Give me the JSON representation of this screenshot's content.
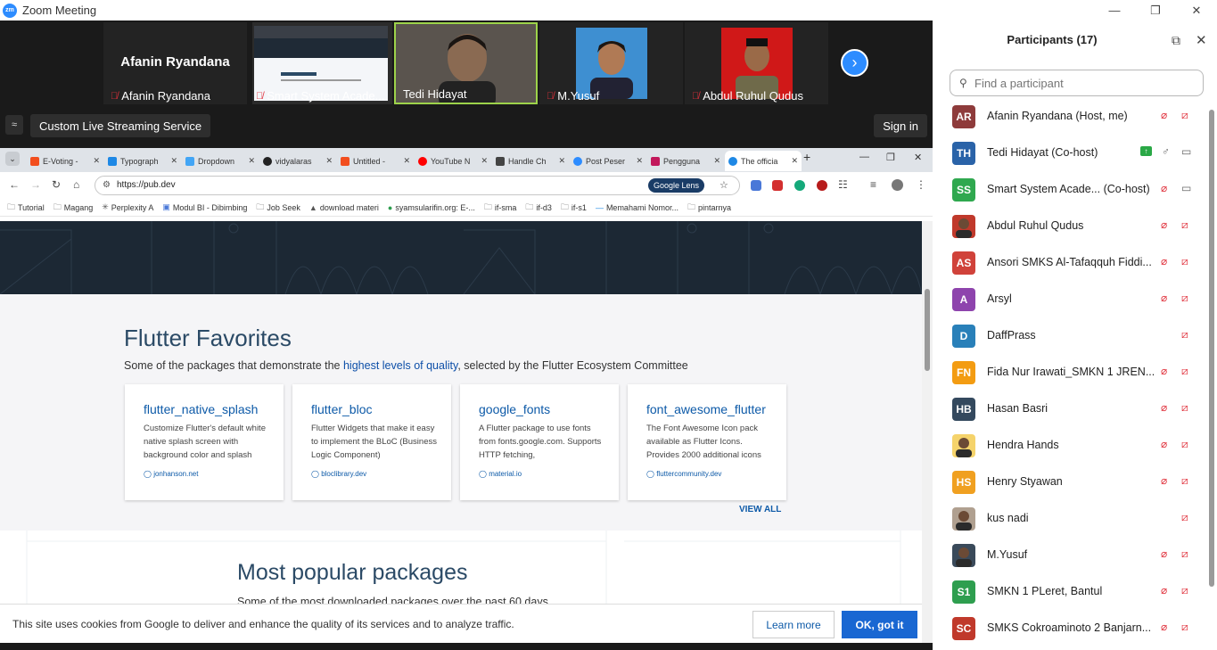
{
  "window": {
    "title": "Zoom Meeting"
  },
  "video_tiles": [
    {
      "name": "Afanin Ryandana",
      "big_name": "Afanin Ryandana",
      "muted": true,
      "bg": "#232323"
    },
    {
      "name": "Smart System Acade...",
      "muted": true,
      "bg": "#ffffff"
    },
    {
      "name": "Tedi Hidayat",
      "muted": false,
      "bg": "#4a4440"
    },
    {
      "name": "M.Yusuf",
      "muted": true,
      "bg": "#232323"
    },
    {
      "name": "Abdul Ruhul Qudus",
      "muted": true,
      "bg": "#232323"
    }
  ],
  "streaming": {
    "label": "Custom Live Streaming Service",
    "sign_in": "Sign in"
  },
  "browser": {
    "tabs": [
      {
        "label": "E-Voting - ",
        "color": "#f24e1e"
      },
      {
        "label": "Typograph",
        "color": "#1e88e5"
      },
      {
        "label": "Dropdown",
        "color": "#42a5f5"
      },
      {
        "label": "vidyalaras",
        "color": "#222222"
      },
      {
        "label": "Untitled - ",
        "color": "#f24e1e"
      },
      {
        "label": "YouTube N",
        "color": "#ff0000"
      },
      {
        "label": "Handle Ch",
        "color": "#444444"
      },
      {
        "label": "Post Peser",
        "color": "#2d8cff"
      },
      {
        "label": "Pengguna",
        "color": "#c2185b"
      },
      {
        "label": "The officia",
        "color": "#1e88e5"
      }
    ],
    "url": "https://pub.dev",
    "google_lens": "Google Lens",
    "bookmarks": [
      "Tutorial",
      "Magang",
      "Perplexity A",
      "Modul BI - Dibimbing",
      "Job Seek",
      "download materi",
      "syamsularifin.org: E-...",
      "if-sma",
      "if-d3",
      "if-s1",
      "Memahami Nomor...",
      "pintarnya"
    ]
  },
  "page": {
    "favorites_title": "Flutter Favorites",
    "favorites_sub_pre": "Some of the packages that demonstrate the ",
    "favorites_sub_link": "highest levels of quality",
    "favorites_sub_post": ", selected by the Flutter Ecosystem Committee",
    "cards": [
      {
        "name": "flutter_native_splash",
        "desc": "Customize Flutter's default white native splash screen with background color and splash",
        "link": "jonhanson.net"
      },
      {
        "name": "flutter_bloc",
        "desc": "Flutter Widgets that make it easy to implement the BLoC (Business Logic Component)",
        "link": "bloclibrary.dev"
      },
      {
        "name": "google_fonts",
        "desc": "A Flutter package to use fonts from fonts.google.com. Supports HTTP fetching,",
        "link": "material.io"
      },
      {
        "name": "font_awesome_flutter",
        "desc": "The Font Awesome Icon pack available as Flutter Icons. Provides 2000 additional icons",
        "link": "fluttercommunity.dev"
      }
    ],
    "view_all": "VIEW ALL",
    "popular_title": "Most popular packages",
    "popular_sub": "Some of the most downloaded packages over the past 60 days",
    "cookie_text": "This site uses cookies from Google to deliver and enhance the quality of its services and to analyze traffic.",
    "learn_more": "Learn more",
    "ok_got_it": "OK, got it"
  },
  "participants": {
    "title": "Participants (17)",
    "search_placeholder": "Find a participant",
    "list": [
      {
        "initials": "AR",
        "name": "Afanin Ryandana (Host, me)",
        "color": "#8e3b3b",
        "mic": "off",
        "cam": "off"
      },
      {
        "initials": "TH",
        "name": "Tedi Hidayat (Co-host)",
        "color": "#2a63a8",
        "mic": "on",
        "cam": "on",
        "share": true
      },
      {
        "initials": "SS",
        "name": "Smart System Acade...  (Co-host)",
        "color": "#2fa84f",
        "mic": "off",
        "cam": "on"
      },
      {
        "initials": "",
        "name": "Abdul Ruhul Qudus",
        "color": "#c0392b",
        "mic": "off",
        "cam": "off",
        "photo": true
      },
      {
        "initials": "AS",
        "name": "Ansori SMKS Al-Tafaqquh Fiddi...",
        "color": "#d0423a",
        "mic": "off",
        "cam": "off"
      },
      {
        "initials": "A",
        "name": "Arsyl",
        "color": "#8e44ad",
        "mic": "off",
        "cam": "off"
      },
      {
        "initials": "D",
        "name": "DaffPrass",
        "color": "#2980b9",
        "mic": "none",
        "cam": "off"
      },
      {
        "initials": "FN",
        "name": "Fida Nur Irawati_SMKN 1 JREN...",
        "color": "#f39c12",
        "mic": "off",
        "cam": "off"
      },
      {
        "initials": "HB",
        "name": "Hasan Basri",
        "color": "#34495e",
        "mic": "off",
        "cam": "off"
      },
      {
        "initials": "",
        "name": "Hendra Hands",
        "color": "#f5d36b",
        "mic": "off",
        "cam": "off",
        "photo": true
      },
      {
        "initials": "HS",
        "name": "Henry Styawan",
        "color": "#f0a020",
        "mic": "off",
        "cam": "off"
      },
      {
        "initials": "",
        "name": "kus nadi",
        "color": "#b0a090",
        "mic": "none",
        "cam": "off",
        "photo": true
      },
      {
        "initials": "",
        "name": "M.Yusuf",
        "color": "#3a4a5a",
        "mic": "off",
        "cam": "off",
        "photo": true
      },
      {
        "initials": "S1",
        "name": "SMKN 1 PLeret, Bantul",
        "color": "#2e9e4f",
        "mic": "off",
        "cam": "off"
      },
      {
        "initials": "SC",
        "name": "SMKS Cokroaminoto 2 Banjarn...",
        "color": "#c0392b",
        "mic": "off",
        "cam": "off"
      }
    ]
  }
}
